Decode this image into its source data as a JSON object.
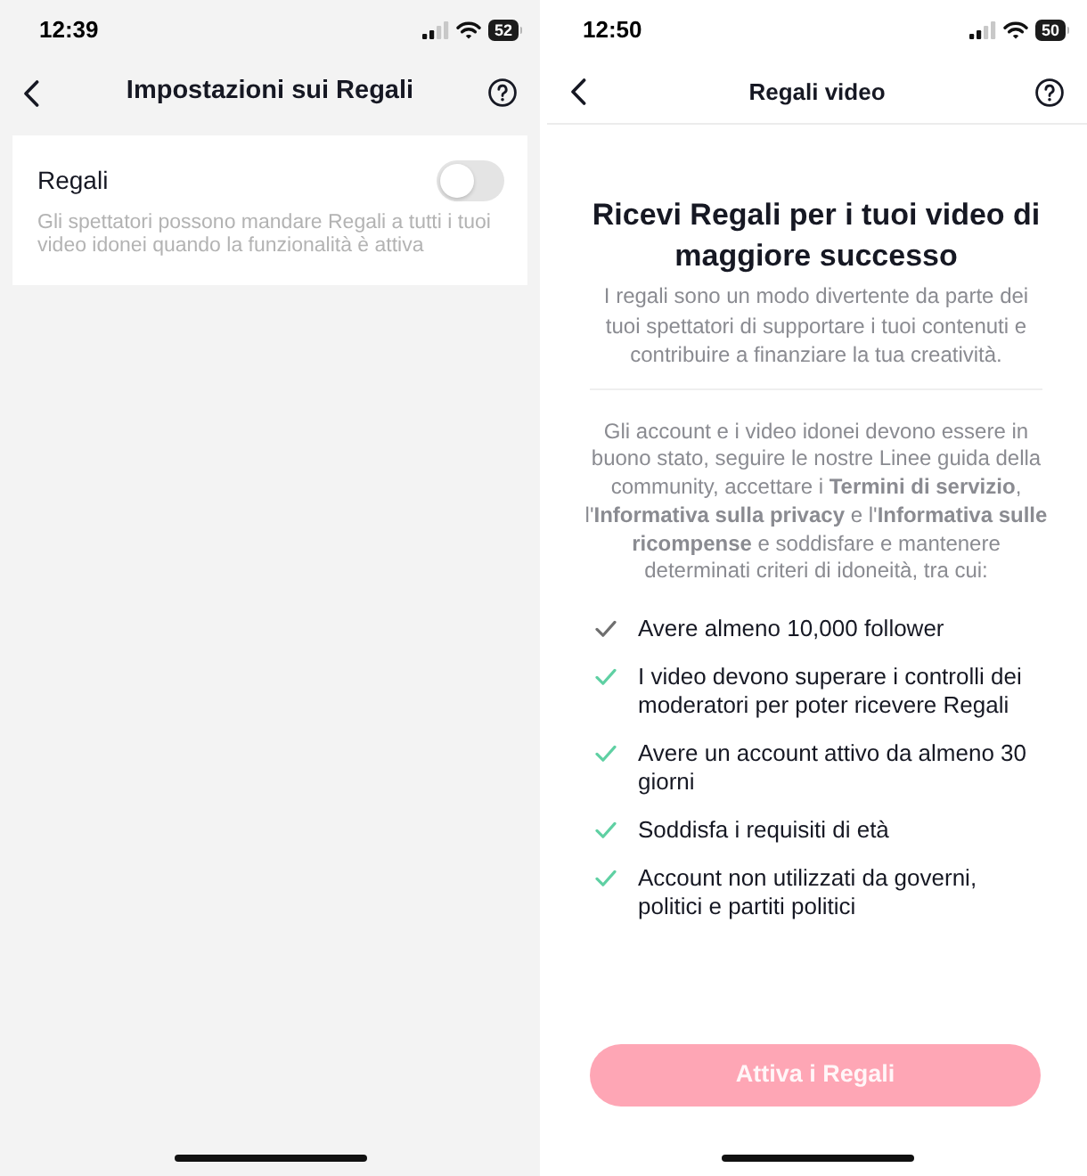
{
  "settings_screen": {
    "status_bar": {
      "time": "12:39",
      "battery": "52"
    },
    "header": {
      "title": "Impostazioni sui Regali"
    },
    "setting": {
      "label": "Regali",
      "on": false,
      "description": "Gli spettatori possono mandare Regali a tutti i tuoi video idonei quando la funzionalità è attiva"
    }
  },
  "info_screen": {
    "status_bar": {
      "time": "12:50",
      "battery": "50"
    },
    "header": {
      "title": "Regali video"
    },
    "heading": "Ricevi Regali per i tuoi video di maggiore successo",
    "intro": "I regali sono un modo divertente da parte dei tuoi spettatori di supportare i tuoi contenuti e contribuire a finanziare la tua creatività.",
    "details": "Gli account e i video idonei devono essere in buono stato, seguire le nostre Linee guida della community, accettare i **Termini di servizio**, l'**Informativa sulla privacy** e l'**Informativa sulle ricompense** e soddisfare e mantenere determinati criteri di idoneità, tra cui:",
    "requirements": [
      {
        "text": "Avere almeno 10,000 follower",
        "met": false
      },
      {
        "text": "I video devono superare i controlli dei moderatori per poter ricevere Regali",
        "met": true
      },
      {
        "text": "Avere un account attivo da almeno 30 giorni",
        "met": true
      },
      {
        "text": "Soddisfa i requisiti di età",
        "met": true
      },
      {
        "text": "Account non utilizzati da governi, politici e partiti politici",
        "met": true
      }
    ],
    "button": {
      "label": "Attiva i Regali",
      "disabled": true
    }
  }
}
